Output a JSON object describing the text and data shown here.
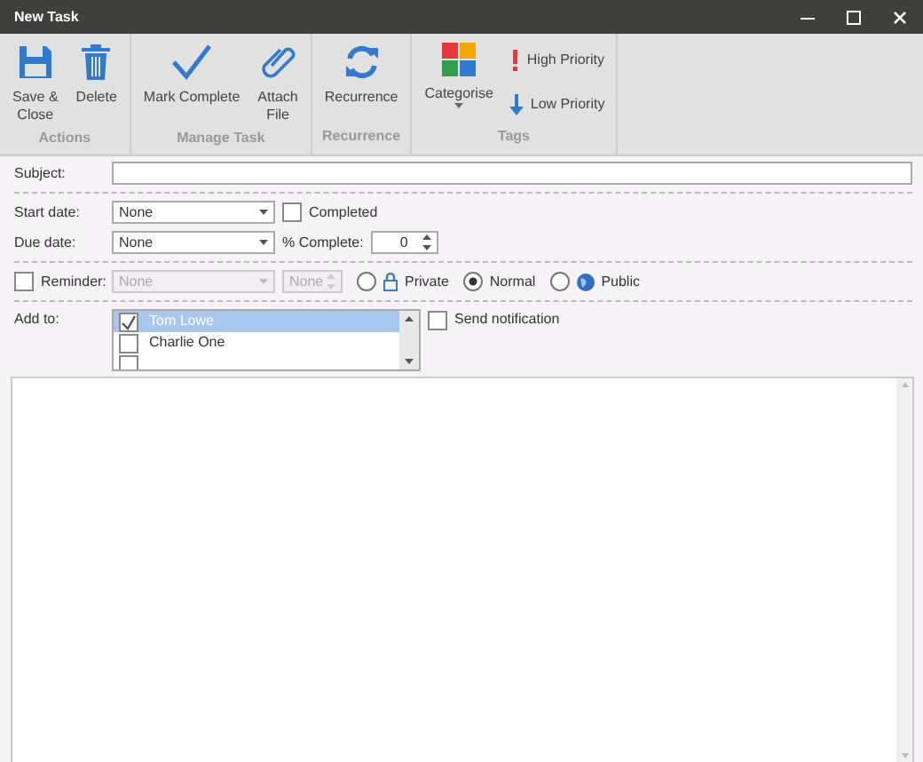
{
  "window": {
    "title": "New Task"
  },
  "ribbon": {
    "groups": [
      {
        "label": "Actions",
        "buttons": [
          {
            "label": "Save & Close",
            "kind": "save"
          },
          {
            "label": "Delete",
            "kind": "delete"
          }
        ]
      },
      {
        "label": "Manage Task",
        "buttons": [
          {
            "label": "Mark Complete",
            "kind": "check"
          },
          {
            "label": "Attach File",
            "kind": "attach"
          }
        ]
      },
      {
        "label": "Recurrence",
        "buttons": [
          {
            "label": "Recurrence",
            "kind": "recur"
          }
        ]
      },
      {
        "label": "Tags",
        "buttons": [
          {
            "label": "Categorise",
            "kind": "categorise"
          },
          {
            "label": "High Priority",
            "kind": "high"
          },
          {
            "label": "Low Priority",
            "kind": "low"
          }
        ]
      }
    ]
  },
  "form": {
    "subject": {
      "label": "Subject:"
    },
    "start_date": {
      "label": "Start date:",
      "value": "None"
    },
    "completed": {
      "label": "Completed",
      "checked": false
    },
    "due_date": {
      "label": "Due date:",
      "value": "None"
    },
    "percent_complete": {
      "label": "% Complete:",
      "value": "0"
    },
    "reminder": {
      "label": "Reminder:",
      "checked": false,
      "disabled": true,
      "date": "None",
      "time": "None"
    },
    "sensitivity": [
      {
        "label": "Private",
        "kind": "lock",
        "selected": false
      },
      {
        "label": "Normal",
        "kind": "plain",
        "selected": true
      },
      {
        "label": "Public",
        "kind": "globe",
        "selected": false
      }
    ],
    "add_to": {
      "label": "Add to:",
      "items": [
        {
          "label": "Tom Lowe",
          "checked": true,
          "selected": true
        },
        {
          "label": "Charlie One",
          "checked": false,
          "selected": false
        },
        {
          "checked": false,
          "selected": false
        }
      ]
    },
    "send_notification": {
      "label": "Send notification",
      "checked": false
    }
  }
}
